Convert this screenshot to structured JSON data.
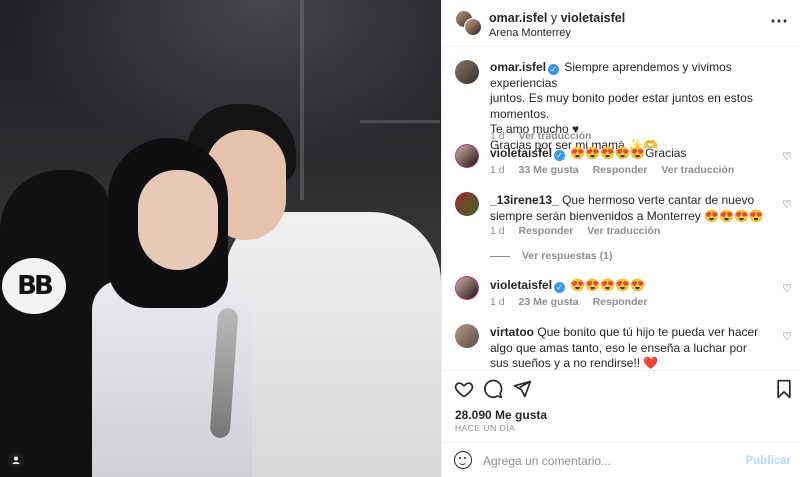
{
  "post": {
    "header": {
      "user1": "omar.isfel",
      "joiner": "y",
      "user2": "violetaisfel",
      "location": "Arena Monterrey",
      "more_icon": "more-horizontal-icon"
    },
    "caption": {
      "user": "omar.isfel",
      "text_lines": [
        "Siempre aprendemos y vivimos experiencias",
        "juntos. Es muy bonito poder estar juntos en estos momentos.",
        "Te amo mucho ♥",
        "Gracias por ser mi mamá ✨🫶"
      ],
      "time": "1 d",
      "translate": "Ver traducción"
    },
    "comments": [
      {
        "user": "violetaisfel",
        "verified": true,
        "text": "😍😍😍😍😍Gracias",
        "time": "1 d",
        "likes": "33 Me gusta",
        "reply": "Responder",
        "translate": "Ver traducción"
      },
      {
        "user": "_13irene13_",
        "verified": false,
        "text": "Que hermoso verte cantar de nuevo siempre serán bienvenidos a Monterrey 😍😍😍😍",
        "time": "1 d",
        "reply": "Responder",
        "translate": "Ver traducción",
        "view_replies": "Ver respuestas (1)"
      },
      {
        "user": "violetaisfel",
        "verified": true,
        "text": "😍😍😍😍😍",
        "time": "1 d",
        "likes": "23 Me gusta",
        "reply": "Responder"
      },
      {
        "user": "virtatoo",
        "verified": false,
        "text": "Que bonito que tú hijo te pueda ver hacer algo que amas tanto, eso le enseña a luchar por sus sueños y a no rendirse!! ❤️"
      }
    ],
    "likes": "28.090 Me gusta",
    "when": "HACE UN DÍA",
    "composer": {
      "placeholder": "Agrega un comentario...",
      "post_label": "Publicar"
    },
    "photo": {
      "logo_text": "BB"
    }
  },
  "icons": {
    "like": "heart-icon",
    "comment": "comment-icon",
    "share": "share-icon",
    "save": "bookmark-icon",
    "emoji": "emoji-icon"
  },
  "colors": {
    "verified": "#3897f0",
    "muted": "#8e8e8e",
    "publish_disabled": "#b3dbff",
    "red_heart": "#ed4956"
  }
}
